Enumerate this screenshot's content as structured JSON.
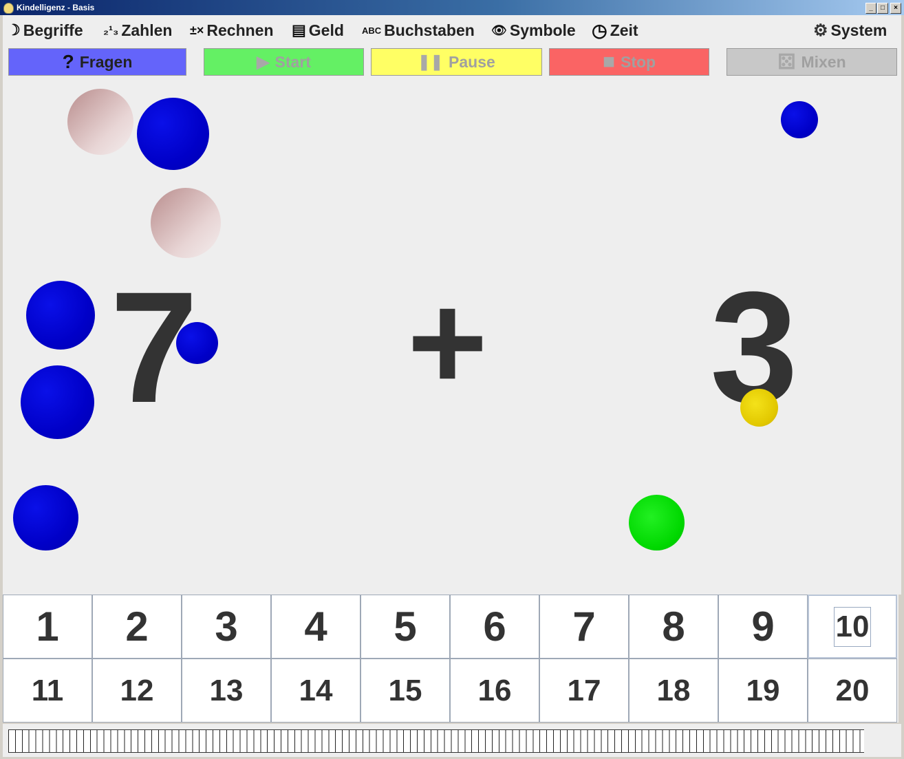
{
  "window": {
    "title": "Kindelligenz - Basis",
    "minimize": "_",
    "maximize": "□",
    "close": "×"
  },
  "menu": {
    "items": [
      {
        "label": "Begriffe",
        "icon": "banana-icon",
        "glyph": "☽"
      },
      {
        "label": "Zahlen",
        "icon": "numbers-icon",
        "glyph": "₂¹₃"
      },
      {
        "label": "Rechnen",
        "icon": "math-operators-icon",
        "glyph": "±×"
      },
      {
        "label": "Geld",
        "icon": "money-icon",
        "glyph": "▤"
      },
      {
        "label": "Buchstaben",
        "icon": "abc-icon",
        "glyph": "ABC"
      },
      {
        "label": "Symbole",
        "icon": "eye-icon",
        "glyph": "👁"
      },
      {
        "label": "Zeit",
        "icon": "clock-icon",
        "glyph": "◷"
      }
    ],
    "system": {
      "label": "System",
      "icon": "gear-icon",
      "glyph": "⚙"
    }
  },
  "toolbar": {
    "fragen": {
      "label": "Fragen",
      "icon": "question-icon",
      "glyph": "?",
      "color": "#6464fa"
    },
    "start": {
      "label": "Start",
      "icon": "play-icon",
      "glyph": "▶",
      "color": "#64f064"
    },
    "pause": {
      "label": "Pause",
      "icon": "pause-icon",
      "glyph": "❚❚",
      "color": "#ffff64"
    },
    "stop": {
      "label": "Stop",
      "icon": "stop-icon",
      "glyph": "■",
      "color": "#fa6464"
    },
    "mixen": {
      "label": "Mixen",
      "icon": "dice-icon",
      "glyph": "⚄",
      "color": "#c8c8c8"
    }
  },
  "exercise": {
    "left_operand": "7",
    "operator": "+",
    "right_operand": "3"
  },
  "answers": {
    "row1": [
      "1",
      "2",
      "3",
      "4",
      "5",
      "6",
      "7",
      "8",
      "9",
      "10"
    ],
    "row2": [
      "11",
      "12",
      "13",
      "14",
      "15",
      "16",
      "17",
      "18",
      "19",
      "20"
    ],
    "selected": "10"
  }
}
